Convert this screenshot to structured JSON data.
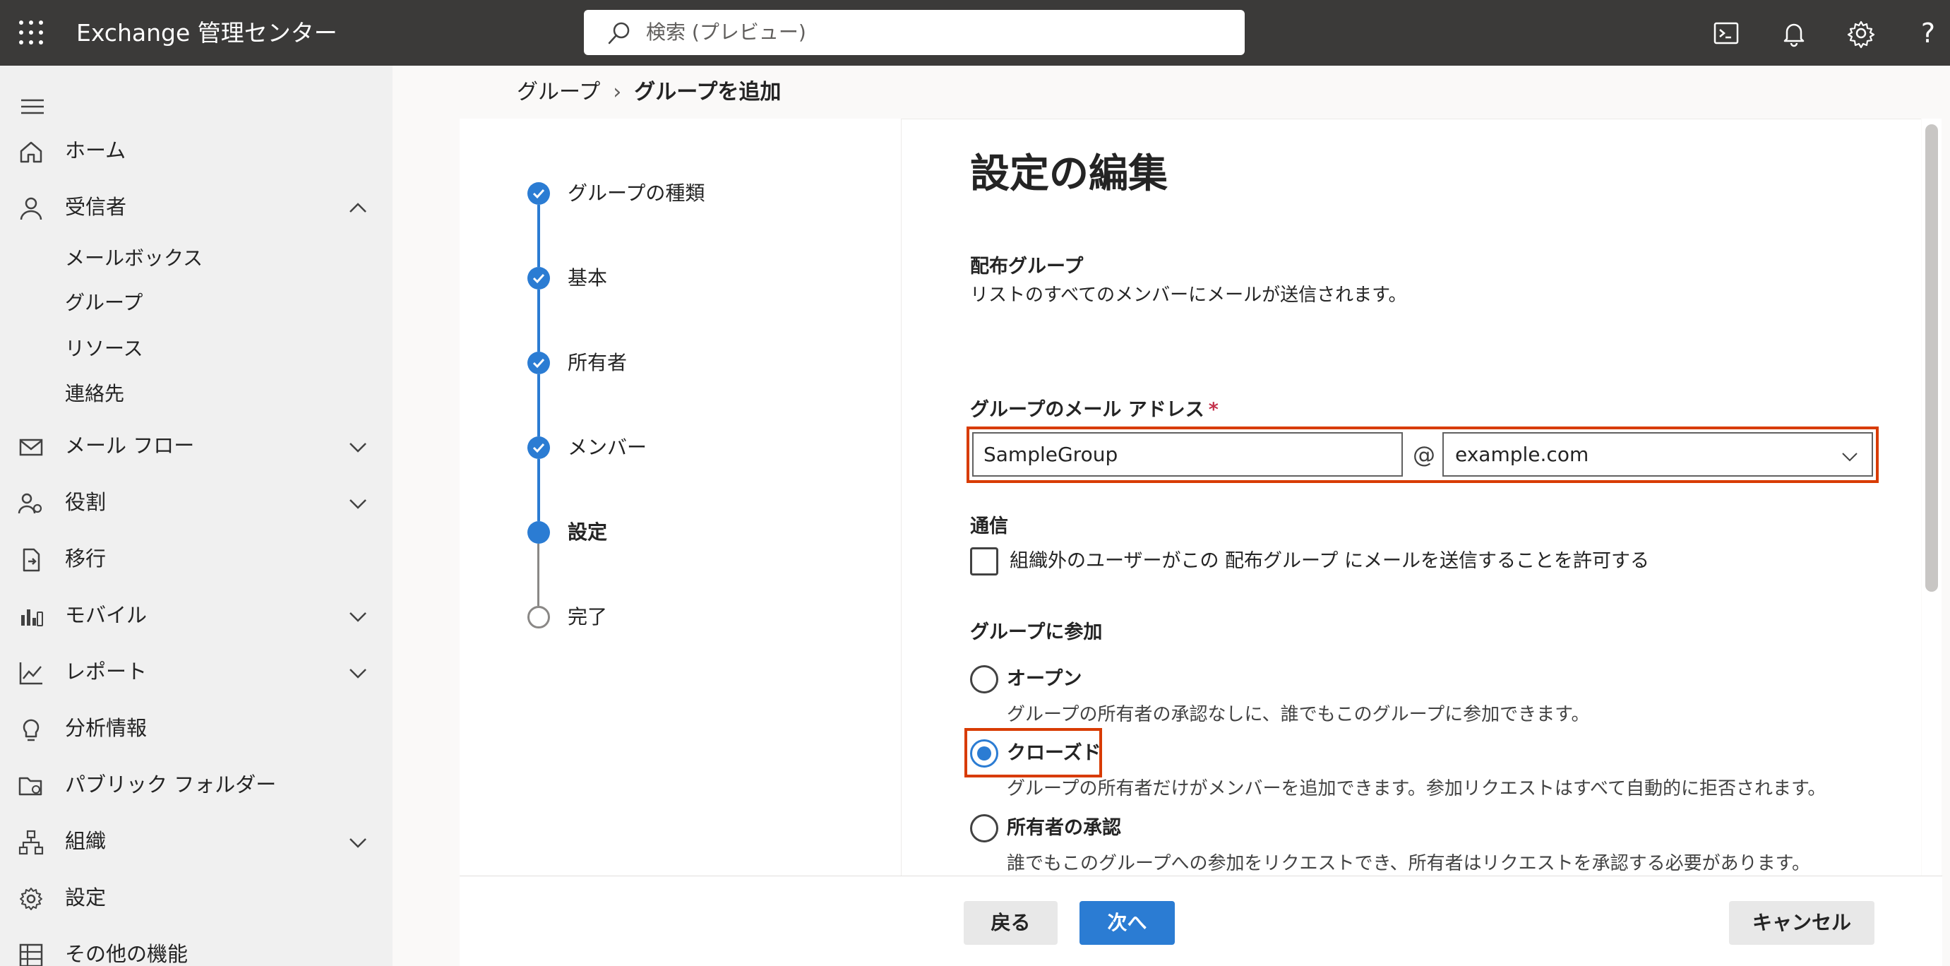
{
  "header": {
    "app_title": "Exchange 管理センター",
    "search_placeholder": "検索 (プレビュー)",
    "help_label": "?"
  },
  "nav": {
    "home": "ホーム",
    "recipients": "受信者",
    "recipients_sub": [
      "メールボックス",
      "グループ",
      "リソース",
      "連絡先"
    ],
    "mail_flow": "メール フロー",
    "roles": "役割",
    "migration": "移行",
    "mobile": "モバイル",
    "reports": "レポート",
    "insights": "分析情報",
    "public_folders": "パブリック フォルダー",
    "organization": "組織",
    "settings": "設定",
    "other_features": "その他の機能"
  },
  "breadcrumb": {
    "root": "グループ",
    "separator": "›",
    "current": "グループを追加"
  },
  "steps": [
    {
      "label": "グループの種類",
      "state": "done"
    },
    {
      "label": "基本",
      "state": "done"
    },
    {
      "label": "所有者",
      "state": "done"
    },
    {
      "label": "メンバー",
      "state": "done"
    },
    {
      "label": "設定",
      "state": "current"
    },
    {
      "label": "完了",
      "state": "future"
    }
  ],
  "form": {
    "title": "設定の編集",
    "group_type_heading": "配布グループ",
    "group_type_desc": "リストのすべてのメンバーにメールが送信されます。",
    "email_label": "グループのメール アドレス",
    "required_mark": "*",
    "email_value": "SampleGroup",
    "at_symbol": "@",
    "domain_value": "example.com",
    "comm_heading": "通信",
    "comm_checkbox_label": "組織外のユーザーがこの 配布グループ にメールを送信することを許可する",
    "comm_checked": false,
    "join_heading": "グループに参加",
    "join_options": [
      {
        "label": "オープン",
        "desc": "グループの所有者の承認なしに、誰でもこのグループに参加できます。",
        "checked": false
      },
      {
        "label": "クローズド",
        "desc": "グループの所有者だけがメンバーを追加できます。参加リクエストはすべて自動的に拒否されます。",
        "checked": true
      },
      {
        "label": "所有者の承認",
        "desc": "誰でもこのグループへの参加をリクエストでき、所有者はリクエストを承認する必要があります。",
        "checked": false
      }
    ]
  },
  "footer": {
    "back": "戻る",
    "next": "次へ",
    "cancel": "キャンセル"
  },
  "colors": {
    "accent": "#2b7cd3",
    "highlight": "#d83b01",
    "topbar": "#3b3a39"
  }
}
